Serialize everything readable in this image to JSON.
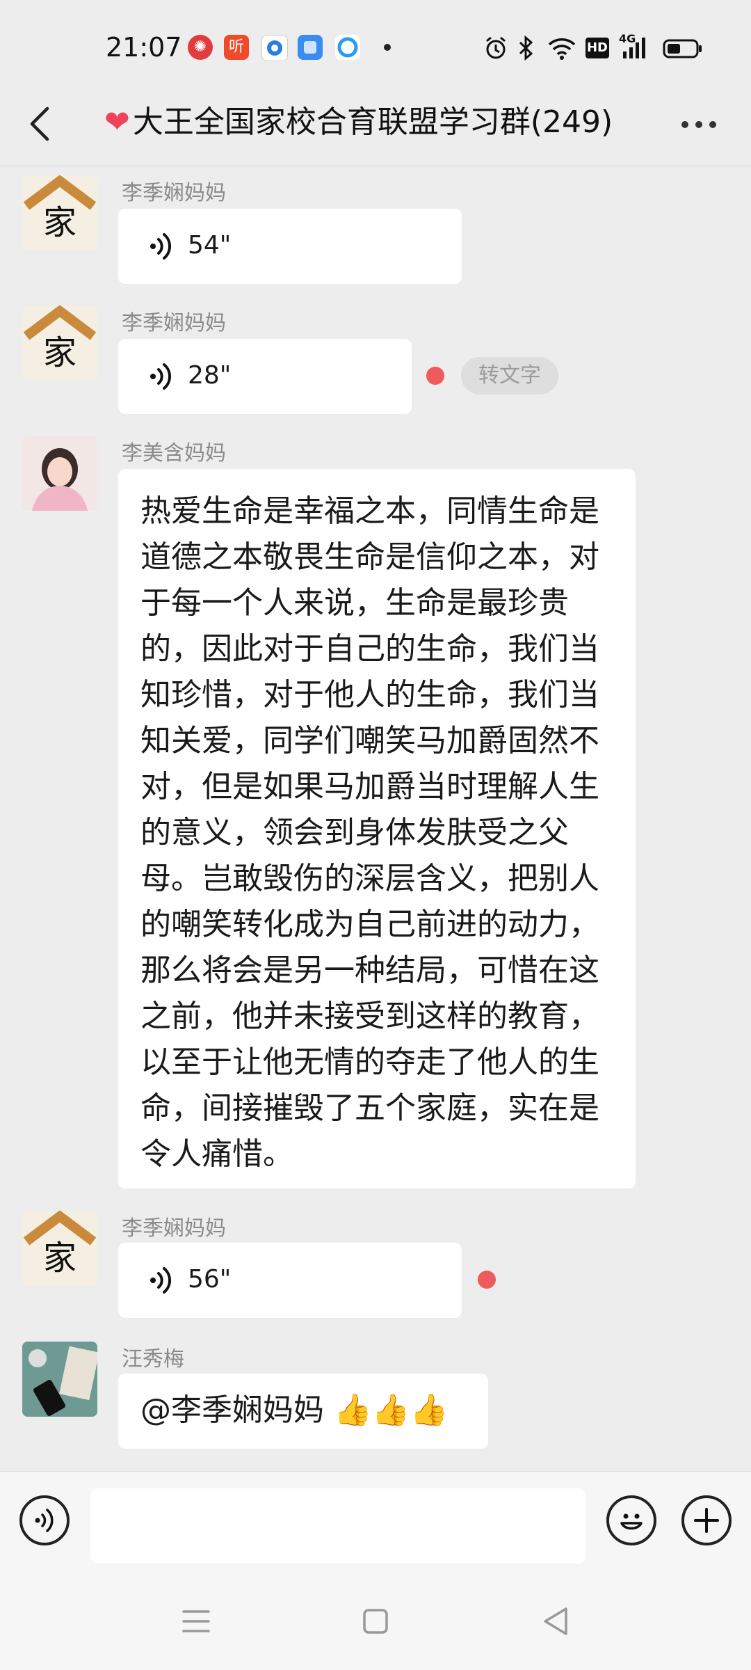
{
  "status_bar": {
    "time": "21:07",
    "left_icons": [
      "news-app-icon",
      "ting-app-icon",
      "browser-app-icon",
      "app-icon",
      "search-app-icon"
    ],
    "right_icons": [
      "alarm-icon",
      "bluetooth-icon",
      "wifi-icon",
      "hd-icon",
      "signal-icon",
      "battery-icon"
    ],
    "app_label_ting": "听",
    "hd_label": "HD",
    "network_label": "4G"
  },
  "header": {
    "heart": "❤",
    "title": "大王全国家校合育联盟学习群(249)"
  },
  "messages": [
    {
      "sender": "李季娴妈妈",
      "type": "voice",
      "duration": "54\"",
      "avatar_char": "家"
    },
    {
      "sender": "李季娴妈妈",
      "type": "voice",
      "duration": "28\"",
      "avatar_char": "家",
      "unread": true,
      "convert_label": "转文字"
    },
    {
      "sender": "李美含妈妈",
      "type": "text",
      "text": "热爱生命是幸福之本，同情生命是道德之本敬畏生命是信仰之本，对于每一个人来说，生命是最珍贵的，因此对于自己的生命，我们当知珍惜，对于他人的生命，我们当知关爱，同学们嘲笑马加爵固然不对，但是如果马加爵当时理解人生的意义，领会到身体发肤受之父母。岂敢毁伤的深层含义，把别人的嘲笑转化成为自己前进的动力，那么将会是另一种结局，可惜在这之前，他并未接受到这样的教育，以至于让他无情的夺走了他人的生命，间接摧毁了五个家庭，实在是令人痛惜。"
    },
    {
      "sender": "李季娴妈妈",
      "type": "voice",
      "duration": "56\"",
      "avatar_char": "家",
      "unread": true
    },
    {
      "sender": "汪秀梅",
      "type": "text",
      "text": "@李季娴妈妈 👍👍👍"
    }
  ],
  "input": {
    "value": "",
    "placeholder": ""
  },
  "colors": {
    "background": "#ededed",
    "bubble": "#ffffff",
    "unread_dot": "#ef5a5a",
    "heart": "#f0435a"
  }
}
